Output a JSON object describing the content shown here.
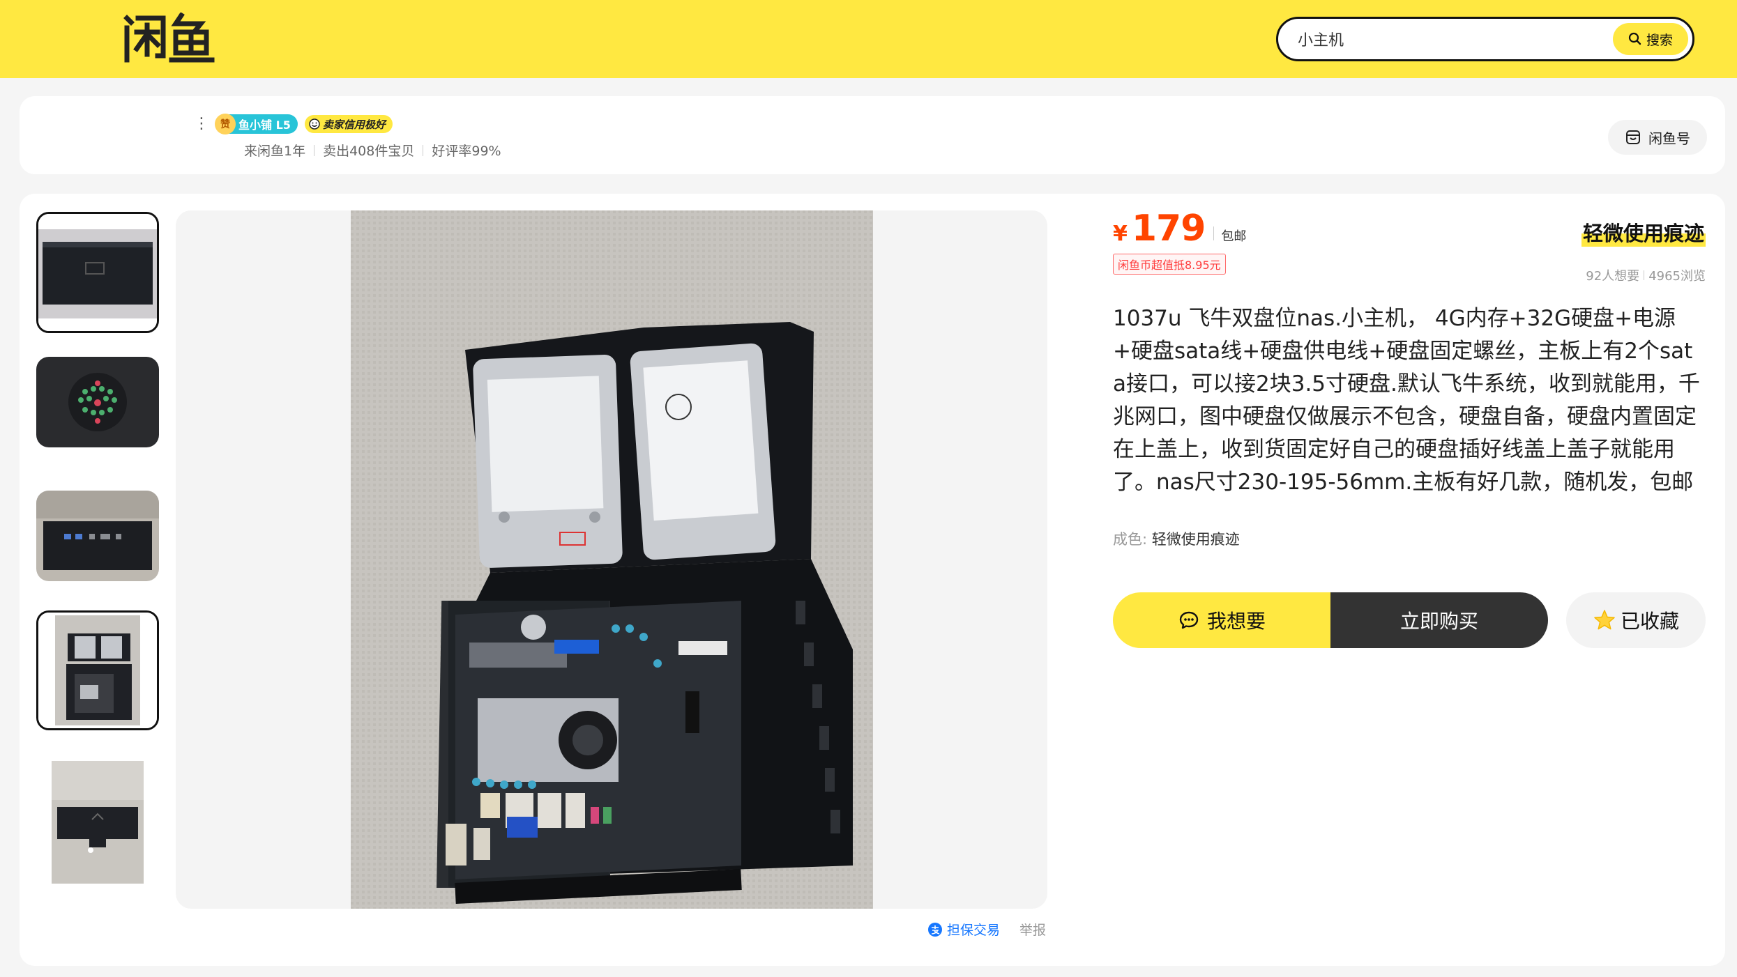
{
  "header": {
    "logo_text": "闲鱼",
    "search": {
      "value": "小主机",
      "button_label": "搜索"
    }
  },
  "seller": {
    "level_badge": "鱼小铺 L5",
    "zan": "赞",
    "credit_badge": "卖家信用极好",
    "stats": [
      "来闲鱼1年",
      "卖出408件宝贝",
      "好评率99%"
    ],
    "fishno_label": "闲鱼号"
  },
  "product": {
    "currency": "¥",
    "price": "179",
    "shipping": "包邮",
    "condition_tag": "轻微使用痕迹",
    "coin_offer": "闲鱼币超值抵8.95元",
    "want_count": "92人想要",
    "views": "4965浏览",
    "description": "1037u 飞牛双盘位nas.小主机， 4G内存+32G硬盘+电源+硬盘sata线+硬盘供电线+硬盘固定螺丝，主板上有2个sata接口，可以接2块3.5寸硬盘.默认飞牛系统，收到就能用，千兆网口，图中硬盘仅做展示不包含，硬盘自备，硬盘内置固定在上盖上，收到货固定好自己的硬盘插好线盖上盖子就能用了。nas尺寸230-195-56mm.主板有好几款，随机发，包邮非偏远",
    "quality_label": "成色:",
    "quality_value": "轻微使用痕迹"
  },
  "actions": {
    "want": "我想要",
    "buy": "立即购买",
    "favorite": "已收藏"
  },
  "footer_links": {
    "escrow": "担保交易",
    "report": "举报"
  },
  "colors": {
    "brand_yellow": "#ffe841",
    "price_orange": "#ff4400",
    "dark_button": "#333333",
    "escrow_blue": "#1677ff"
  }
}
